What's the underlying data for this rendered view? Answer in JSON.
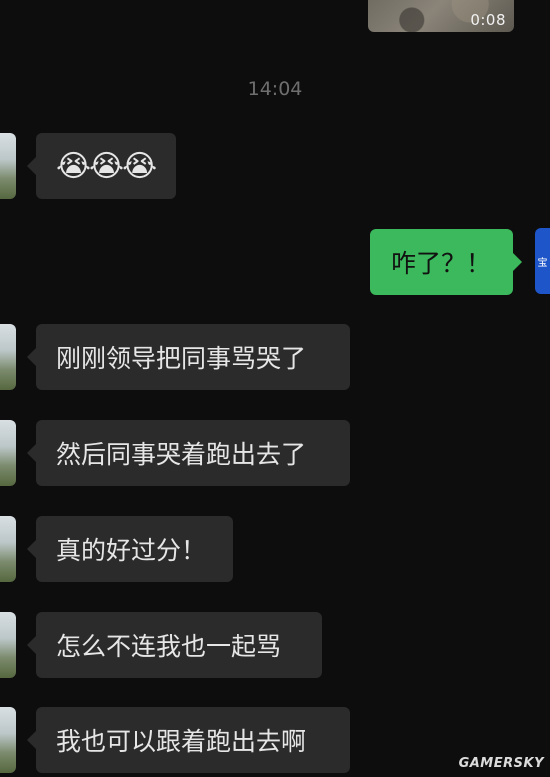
{
  "video": {
    "duration": "0:08"
  },
  "timestamp": "14:04",
  "my_message": {
    "text": "咋了？！",
    "avatar_char": "宝"
  },
  "messages": [
    {
      "text": "😭😭😭"
    },
    {
      "text": "刚刚领导把同事骂哭了"
    },
    {
      "text": "然后同事哭着跑出去了"
    },
    {
      "text": "真的好过分！"
    },
    {
      "text": "怎么不连我也一起骂"
    },
    {
      "text": "我也可以跟着跑出去啊"
    }
  ],
  "watermark": "GAMERSKY"
}
